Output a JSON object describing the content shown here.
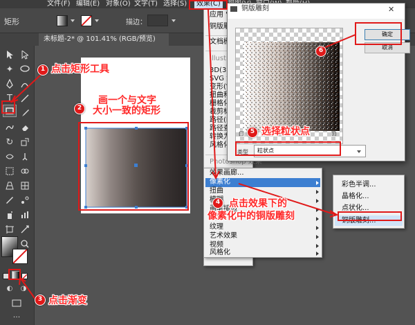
{
  "menubar": {
    "items": [
      "文件(F)",
      "编辑(E)",
      "对象(O)",
      "文字(T)",
      "选择(S)",
      "效果(C)",
      "视图(V)",
      "窗口(W)",
      "帮助(H)"
    ]
  },
  "controlbar": {
    "tool_name": "矩形",
    "stroke_label": "描边："
  },
  "tab": {
    "document": "未标题-2* @ 101.41% (RGB/预览)"
  },
  "effect_menu": {
    "recent_apply": "应用 \"铜...",
    "recent_last": "铜版雕刻...",
    "doc_raster": "文档栅格...",
    "illustrator_header": "Illustrat",
    "illustrator_items": [
      "3D(3)",
      "SVG 滤",
      "变形(W",
      "扭曲和",
      "栅格化",
      "裁剪标",
      "路径(P",
      "路径查",
      "转换为",
      "风格化"
    ],
    "photoshop_header": "Photoshop 效果",
    "photoshop_items": [
      "效果画廊...",
      "像素化",
      "扭曲",
      "模糊",
      "画笔描边",
      "素描",
      "纹理",
      "艺术效果",
      "视频",
      "风格化"
    ]
  },
  "pixelate_submenu": {
    "items": [
      "彩色半调...",
      "晶格化...",
      "点状化...",
      "铜版雕刻..."
    ]
  },
  "dialog": {
    "title": "铜版雕刻",
    "ok": "确定",
    "cancel": "取消",
    "type_label": "类型",
    "type_value": "粒状点"
  },
  "annotations": {
    "step1": {
      "number": "1",
      "text": "点击矩形工具"
    },
    "step2": {
      "number": "2",
      "text_line1": "画一个与文字",
      "text_line2": "大小一致的矩形"
    },
    "step3": {
      "number": "3",
      "text": "点击渐变"
    },
    "step4": {
      "number": "4",
      "text_line1": "点击效果下的",
      "text_line2": "像素化中的铜版雕刻"
    },
    "step5": {
      "number": "5",
      "text": "选择粒状点"
    },
    "step6": {
      "number": "6"
    }
  },
  "colors": {
    "annotation_red": "#e01919",
    "ui_dark": "#535353",
    "menu_light": "#f0f0f0",
    "selection_blue": "#3d7fd1"
  }
}
